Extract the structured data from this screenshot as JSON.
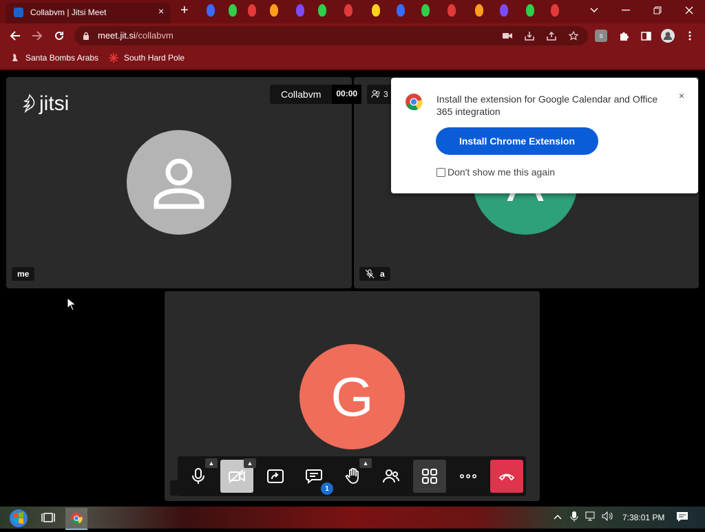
{
  "browser": {
    "tab_title": "Collabvm | Jitsi Meet",
    "tab_close": "×",
    "new_tab": "+",
    "url_host": "meet.jit.si",
    "url_path": "/collabvm",
    "window_controls": [
      "chevron-down-icon",
      "minimize-icon",
      "restore-icon",
      "close-icon"
    ],
    "extension_badge": "s"
  },
  "bookmarks": [
    {
      "label": "Santa Bombs Arabs",
      "icon": "bookmark-icon"
    },
    {
      "label": "South Hard Pole",
      "icon": "snowflake-icon"
    }
  ],
  "meeting": {
    "logo_text": "jitsi",
    "room_name": "Collabvm",
    "timer": "00:00",
    "participant_count": "3",
    "participants": [
      {
        "name": "me",
        "avatar": "person-icon",
        "color": "#b4b4b4"
      },
      {
        "name": "a",
        "avatar_letter": "A",
        "color": "#2ea07a",
        "muted": true
      },
      {
        "name": "",
        "avatar_letter": "G",
        "color": "#f06d5a"
      }
    ]
  },
  "popup": {
    "message": "Install the extension for Google Calendar and Office 365 integration",
    "install_label": "Install Chrome Extension",
    "checkbox_label": "Don't show me this again",
    "close": "×",
    "accent": "#0b5dd7"
  },
  "toolbox": {
    "chat_badge": "1",
    "hangup_color": "#e0334c",
    "buttons": [
      "microphone-icon",
      "camera-off-icon",
      "screen-share-icon",
      "chat-icon",
      "raise-hand-icon",
      "participants-icon",
      "tile-view-icon",
      "more-icon",
      "hangup-icon"
    ]
  },
  "taskbar": {
    "time": "7:38:01 PM"
  },
  "colors": {
    "chrome_bg": "#7d1417",
    "tile_bg": "#2a2a2a"
  }
}
